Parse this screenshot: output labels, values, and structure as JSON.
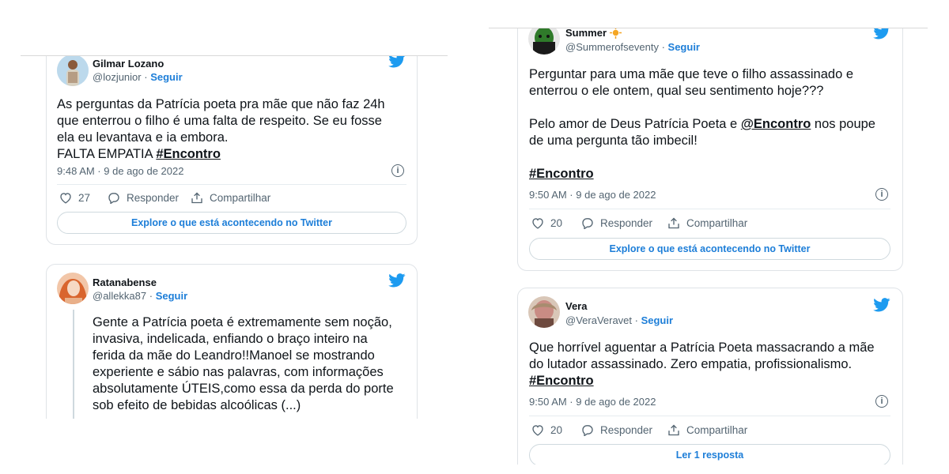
{
  "tweets": {
    "t1": {
      "name": "Gilmar Lozano",
      "handle": "@lozjunior",
      "follow": "Seguir",
      "text": "As perguntas da Patrícia poeta pra mãe que não faz 24h\nque enterrou o filho é uma falta de respeito. Se eu fosse\nela eu levantava e ia embora.\nFALTA EMPATIA  ",
      "hashtag": "#Encontro",
      "timestamp": "9:48 AM · 9 de ago de 2022",
      "likes": "27",
      "reply": "Responder",
      "share": "Compartilhar",
      "cta": "Explore o que está acontecendo no Twitter"
    },
    "t2": {
      "name": "Ratanabense",
      "handle": "@allekka87",
      "follow": "Seguir",
      "text": "Gente a Patrícia poeta é extremamente sem noção,\ninvasiva, indelicada, enfiando o braço inteiro na\nferida da mãe do Leandro!!Manoel se mostrando\nexperiente e sábio nas palavras, com informações\nabsolutamente ÚTEIS,como essa da perda do porte\nsob efeito de bebidas alcoólicas (...)"
    },
    "t3": {
      "name": "Summer",
      "handle": "@Summerofseventy",
      "follow": "Seguir",
      "text1": "Perguntar para uma mãe que teve o filho assassinado e\nenterrou o ele ontem, qual seu sentimento hoje???",
      "text2": "Pelo amor de Deus Patrícia Poeta e ",
      "mention": "@Encontro",
      "text3": " nos poupe\nde uma pergunta tão imbecil!",
      "hashtag": "#Encontro",
      "timestamp": "9:50 AM · 9 de ago de 2022",
      "likes": "20",
      "reply": "Responder",
      "share": "Compartilhar",
      "cta": "Explore o que está acontecendo no Twitter"
    },
    "t4": {
      "name": "Vera",
      "handle": "@VeraVeravet",
      "follow": "Seguir",
      "text": "Que horrível aguentar a Patrícia Poeta massacrando a mãe\ndo lutador assassinado. Zero empatia, profissionalismo.",
      "hashtag": "#Encontro",
      "timestamp": "9:50 AM · 9 de ago de 2022",
      "likes": "20",
      "reply": "Responder",
      "share": "Compartilhar",
      "cta": "Ler 1 resposta"
    }
  },
  "colors": {
    "link": "#1d7ed8",
    "twitter": "#1d9bf0",
    "muted": "#536471"
  },
  "icons": [
    "twitter-bird-icon",
    "heart-icon",
    "reply-bubble-icon",
    "share-icon",
    "info-icon",
    "sun-emoji-icon"
  ]
}
